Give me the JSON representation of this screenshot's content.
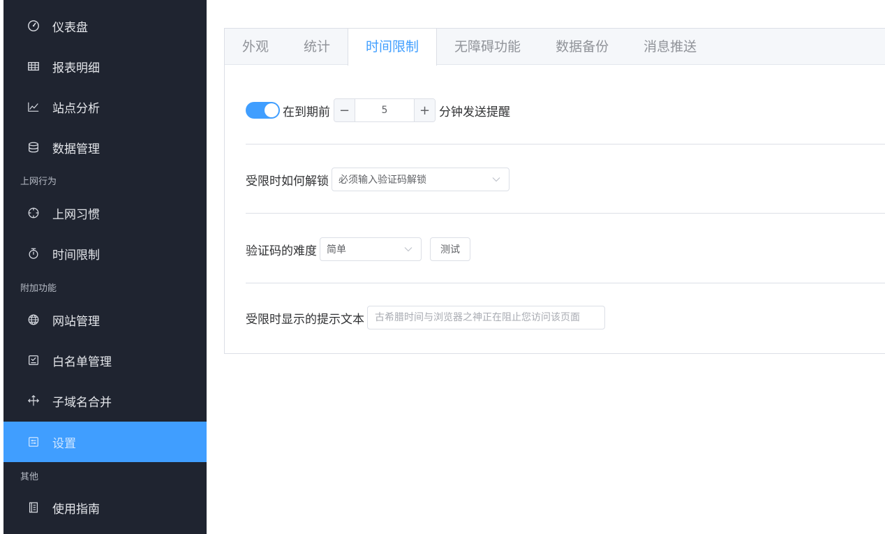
{
  "sidebar": {
    "items": [
      {
        "label": "仪表盘",
        "icon": "dashboard-icon"
      },
      {
        "label": "报表明细",
        "icon": "table-icon"
      },
      {
        "label": "站点分析",
        "icon": "line-chart-icon"
      },
      {
        "label": "数据管理",
        "icon": "database-icon"
      },
      {
        "label": "上网习惯",
        "icon": "crosshair-icon"
      },
      {
        "label": "时间限制",
        "icon": "stopwatch-icon"
      },
      {
        "label": "网站管理",
        "icon": "globe-icon"
      },
      {
        "label": "白名单管理",
        "icon": "checklist-icon"
      },
      {
        "label": "子域名合并",
        "icon": "merge-arrows-icon"
      },
      {
        "label": "设置",
        "icon": "settings-panel-icon"
      },
      {
        "label": "使用指南",
        "icon": "document-icon"
      }
    ],
    "groups": [
      "上网行为",
      "附加功能",
      "其他"
    ],
    "active_color": "#409eff",
    "background": "#1f2430"
  },
  "tabs": [
    {
      "label": "外观"
    },
    {
      "label": "统计"
    },
    {
      "label": "时间限制"
    },
    {
      "label": "无障碍功能"
    },
    {
      "label": "数据备份"
    },
    {
      "label": "消息推送"
    }
  ],
  "active_tab": "时间限制",
  "settings": {
    "reminder": {
      "enabled": true,
      "prefix": "在到期前",
      "minutes": "5",
      "suffix": "分钟发送提醒",
      "minus": "−",
      "plus": "+"
    },
    "unlock": {
      "label": "受限时如何解锁",
      "value": "必须输入验证码解锁"
    },
    "difficulty": {
      "label": "验证码的难度",
      "value": "简单",
      "test_button": "测试"
    },
    "prompt": {
      "label": "受限时显示的提示文本",
      "placeholder": "古希腊时间与浏览器之神正在阻止您访问该页面"
    }
  }
}
